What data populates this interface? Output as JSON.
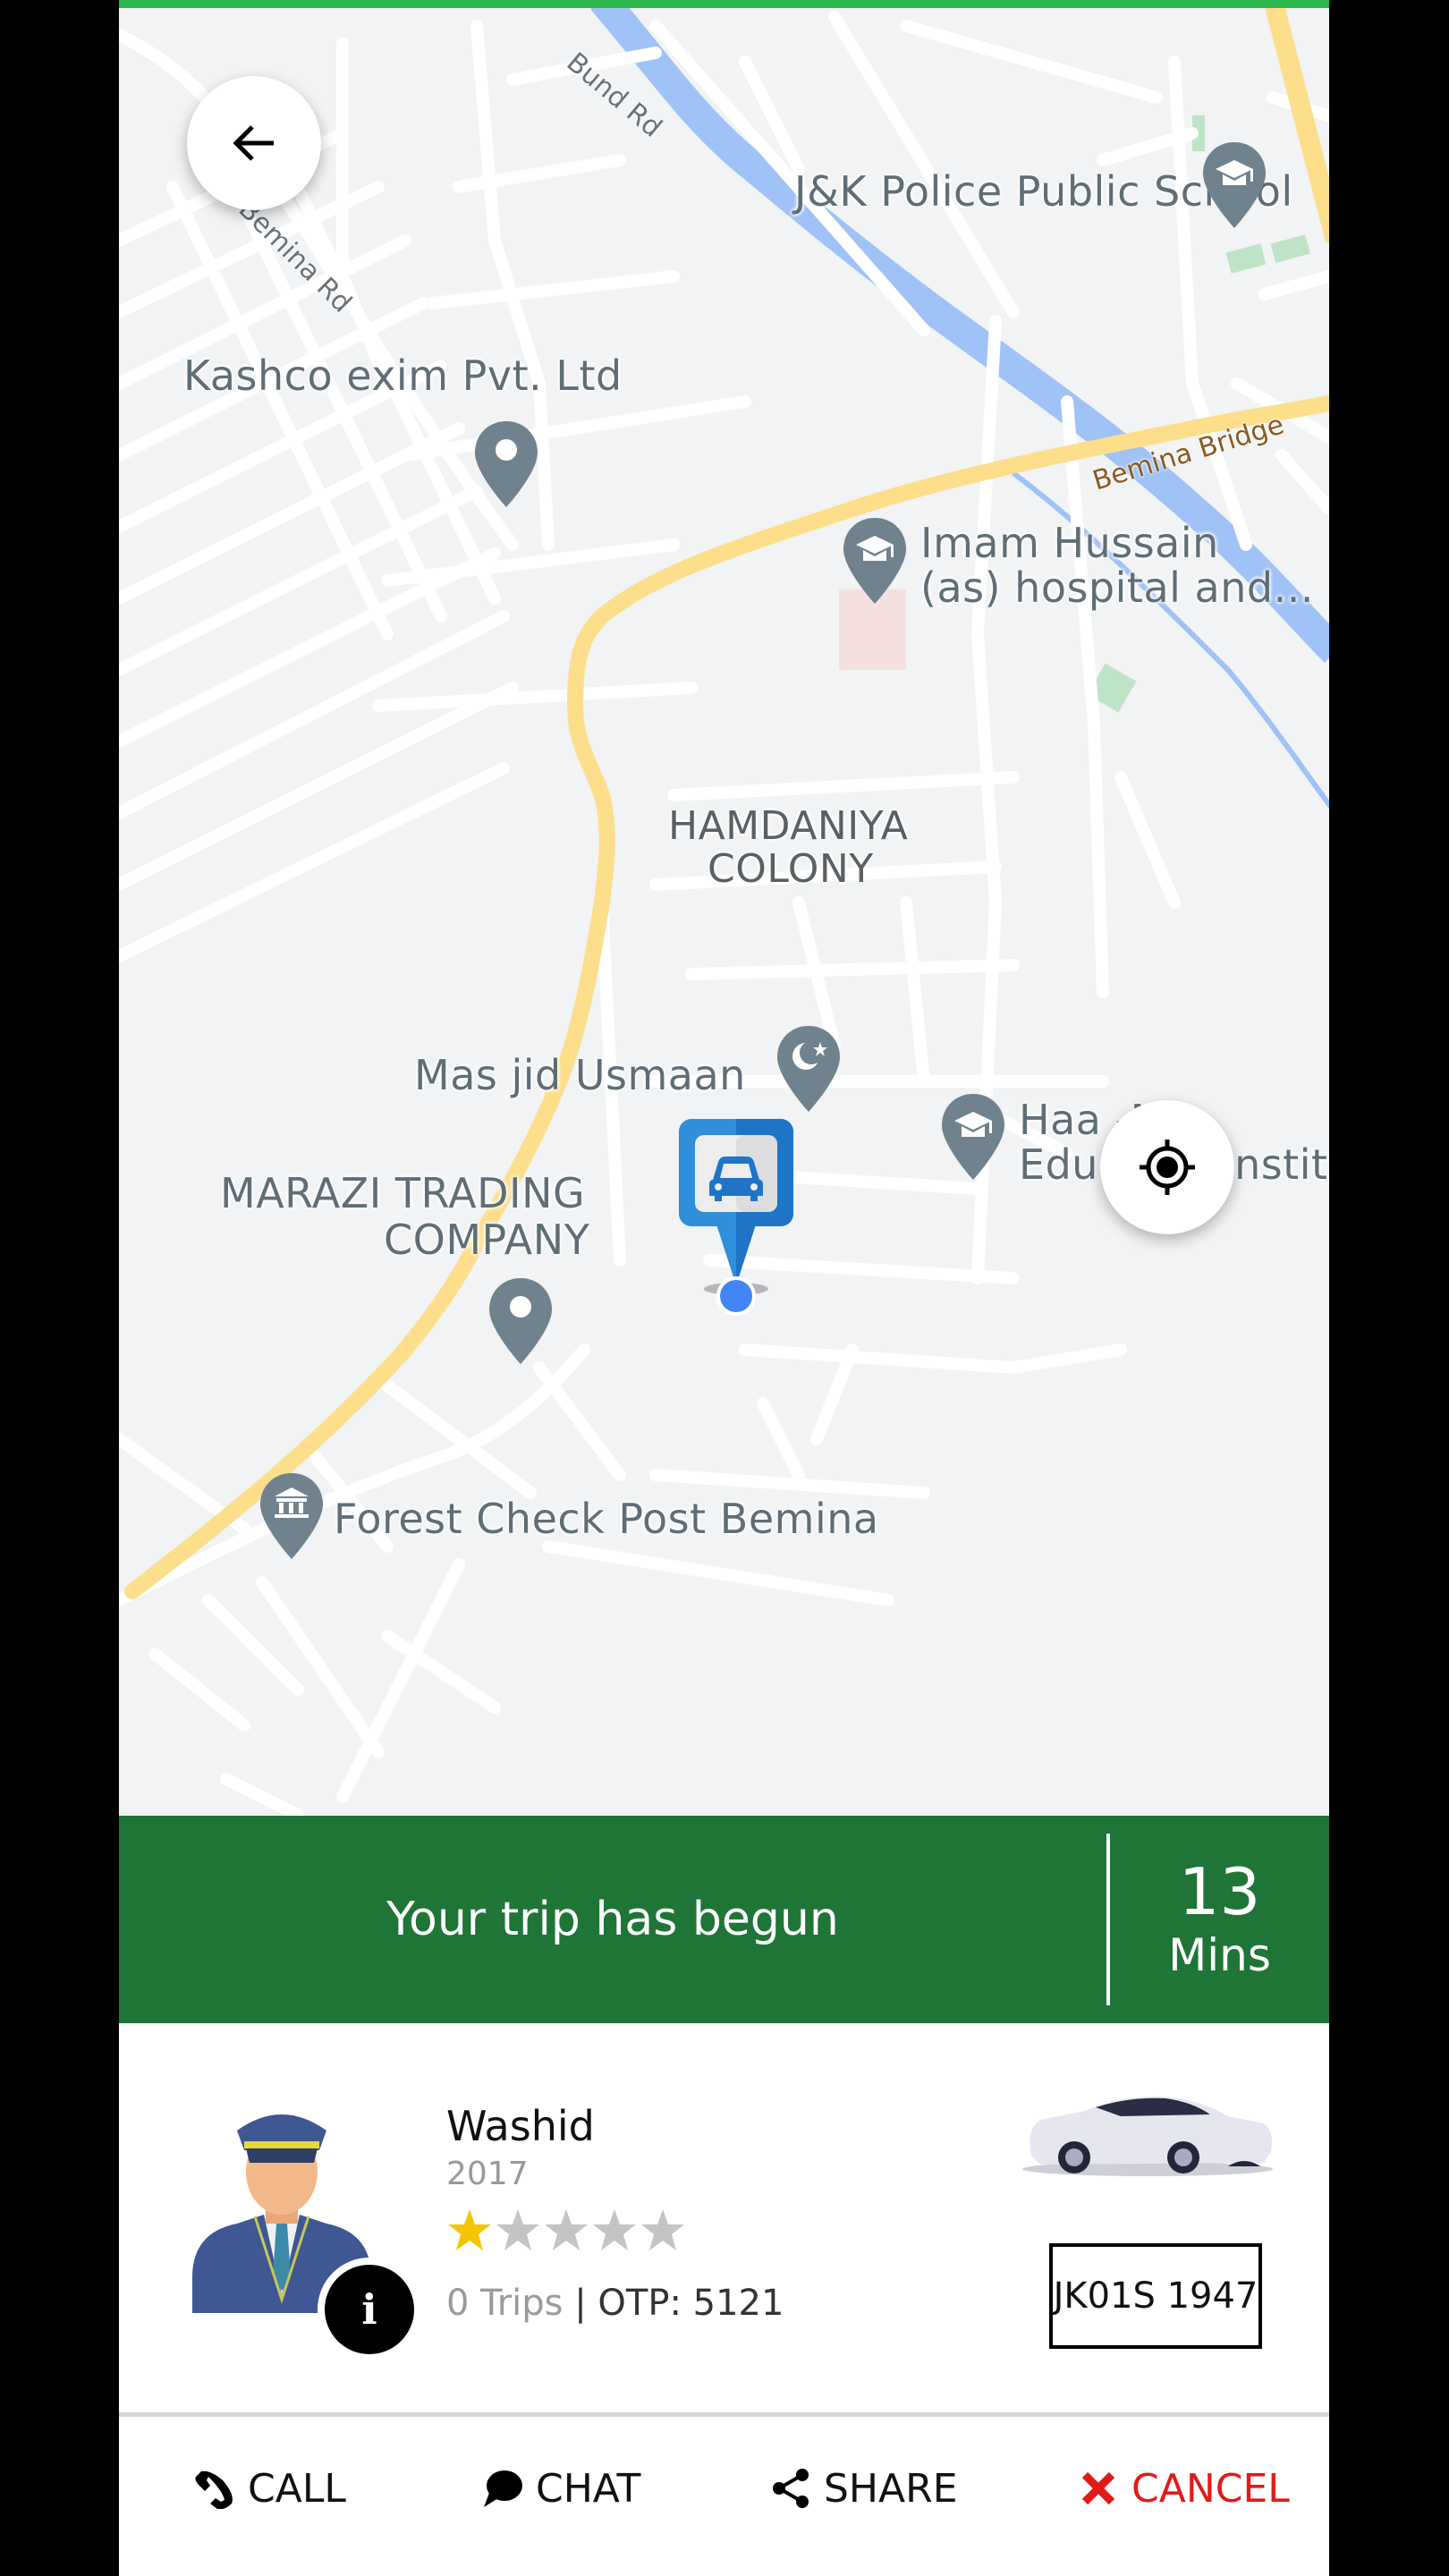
{
  "colors": {
    "top_bar": "#2DB84E",
    "banner_bg": "#1E7536",
    "cancel": "#E21A1A",
    "map_bg": "#F1F3F4",
    "poi_pin": "#6F828E",
    "water": "#9FC2F7",
    "major_road": "#FDDE8A",
    "car_marker": "#2F8FDA",
    "location_dot": "#4285F4",
    "star_filled": "#F6C500",
    "star_empty": "#C4C4C4"
  },
  "map": {
    "road_labels": [
      "Bund Rd",
      "Bemina Rd",
      "Bemina Bridge"
    ],
    "poi_labels": {
      "jk_police_school": "J&K Police Public School",
      "kashco": "Kashco exim Pvt. Ltd",
      "imam_hussain_1": "Imam Hussain",
      "imam_hussain_2": "(as) hospital and...",
      "hamdaniya_1": "HAMDANIYA",
      "hamdaniya_2": "COLONY",
      "masjid": "Mas jid Usmaan",
      "haa_1": "Haa -M",
      "haa_2": "Educ",
      "haa_3": "Instit",
      "marazi_1": "MARAZI TRADING",
      "marazi_2": "COMPANY",
      "forest": "Forest Check Post Bemina"
    },
    "back_button_icon": "arrow-left-icon",
    "locate_button_icon": "crosshair-icon"
  },
  "banner": {
    "message": "Your trip has begun",
    "eta_value": "13",
    "eta_unit": "Mins"
  },
  "driver": {
    "name": "Washid",
    "year": "2017",
    "rating": 1,
    "rating_max": 5,
    "trips": "0 Trips",
    "separator": " | ",
    "otp": "OTP: 5121",
    "info_icon": "i",
    "plate": "JK01S 1947"
  },
  "actions": [
    {
      "label": "CALL",
      "icon": "phone-icon"
    },
    {
      "label": "CHAT",
      "icon": "chat-bubble-icon"
    },
    {
      "label": "SHARE",
      "icon": "share-icon"
    },
    {
      "label": "CANCEL",
      "icon": "close-x-icon"
    }
  ]
}
